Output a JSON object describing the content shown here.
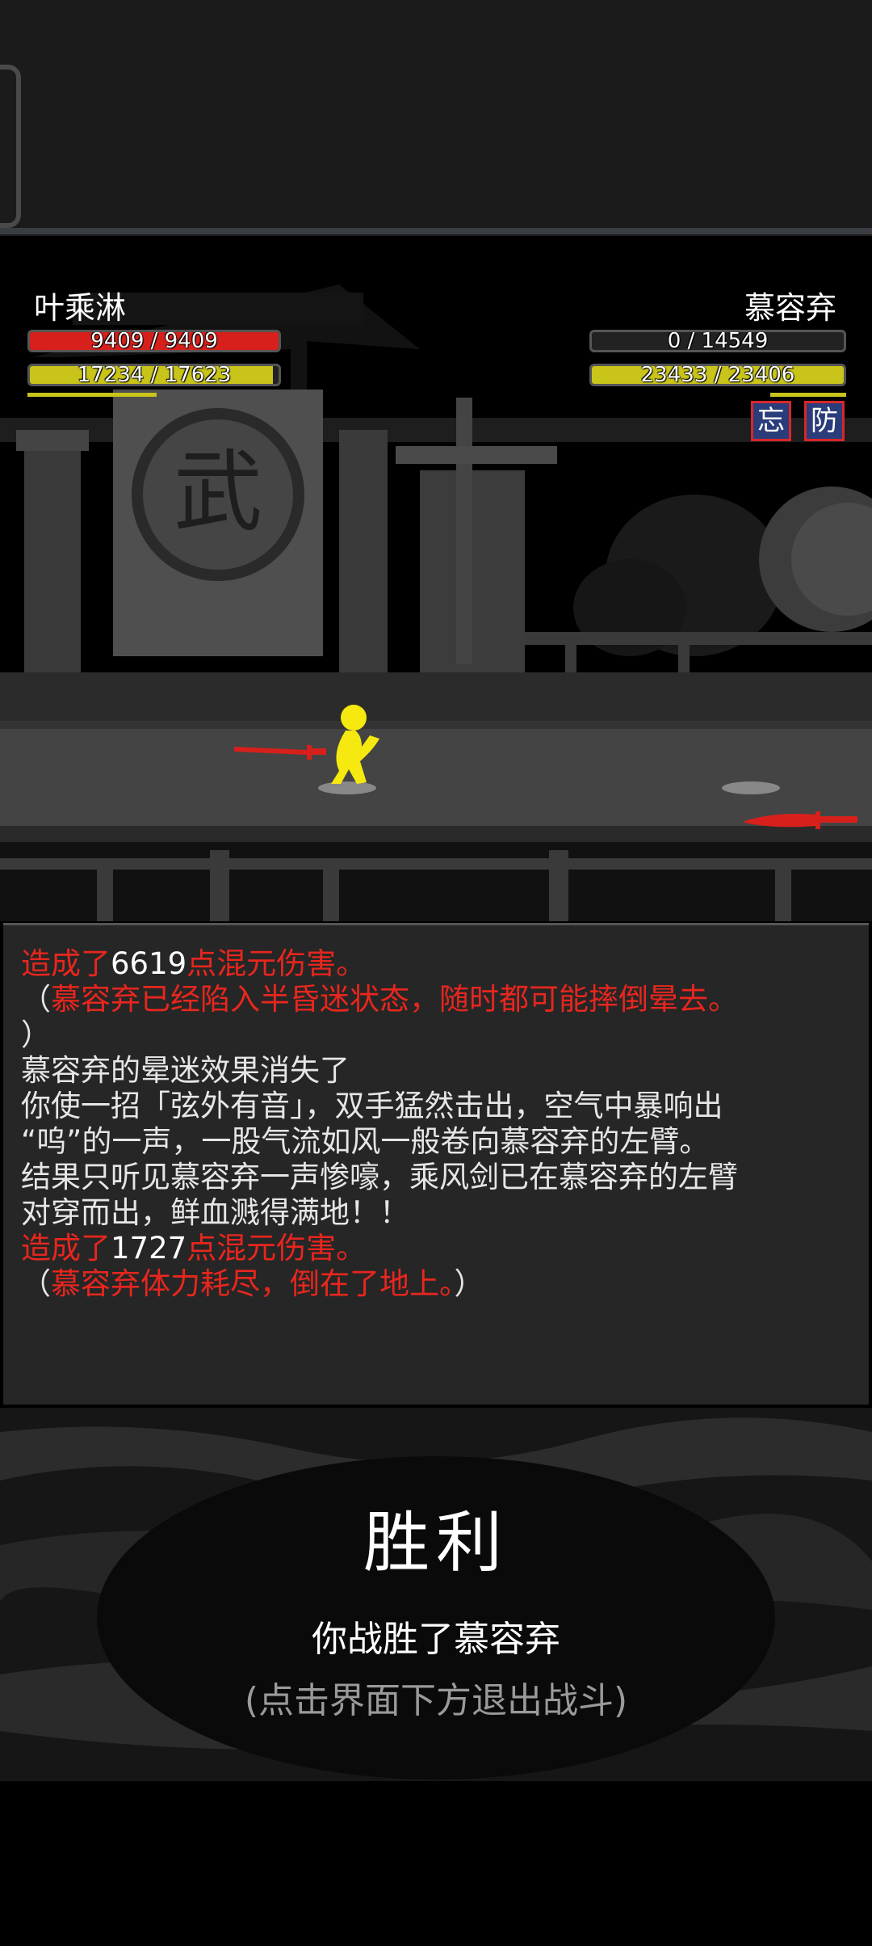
{
  "player": {
    "name": "叶乘淋",
    "hp": {
      "text": "9409 / 9409",
      "ratio": 1.0,
      "color": "#d7201c"
    },
    "mp": {
      "text": "17234 / 17623",
      "ratio": 0.978,
      "color": "#c8c41a"
    }
  },
  "enemy": {
    "name": "慕容弃",
    "hp": {
      "text": "0 / 14549",
      "ratio": 0.0,
      "color": "#d7201c"
    },
    "mp": {
      "text": "23433 / 23406",
      "ratio": 1.0,
      "color": "#c8c41a"
    },
    "status_badges": [
      "忘",
      "防"
    ]
  },
  "scene": {
    "sign_char": "武"
  },
  "battle_log": [
    [
      {
        "t": "造成了",
        "c": "red"
      },
      {
        "t": "6619",
        "c": "wht"
      },
      {
        "t": "点混元伤害。",
        "c": "red"
      }
    ],
    [
      {
        "t": "（",
        "c": ""
      },
      {
        "t": "慕容弃已经陷入半昏迷状态，随时都可能摔倒晕去。",
        "c": "red"
      }
    ],
    [
      {
        "t": "）",
        "c": ""
      }
    ],
    [
      {
        "t": "慕容弃的晕迷效果消失了",
        "c": ""
      }
    ],
    [
      {
        "t": "你使一招「弦外有音」，双手猛然击出，空气中暴响出",
        "c": ""
      }
    ],
    [
      {
        "t": "“呜”的一声，一股气流如风一般卷向慕容弃的左臂。",
        "c": ""
      }
    ],
    [
      {
        "t": "结果只听见慕容弃一声惨嚎，乘风剑已在慕容弃的左臂",
        "c": ""
      }
    ],
    [
      {
        "t": "对穿而出，鲜血溅得满地！！",
        "c": ""
      }
    ],
    [
      {
        "t": "造成了",
        "c": "red"
      },
      {
        "t": "1727",
        "c": "wht"
      },
      {
        "t": "点混元伤害。",
        "c": "red"
      }
    ],
    [
      {
        "t": "（",
        "c": ""
      },
      {
        "t": "慕容弃体力耗尽，倒在了地上。",
        "c": "red"
      },
      {
        "t": "）",
        "c": ""
      }
    ]
  ],
  "victory": {
    "title": "胜利",
    "subtitle": "你战胜了慕容弃",
    "hint": "(点击界面下方退出战斗)"
  },
  "colors": {
    "accent_red": "#e8261e",
    "player_figure": "#f5e90f"
  }
}
